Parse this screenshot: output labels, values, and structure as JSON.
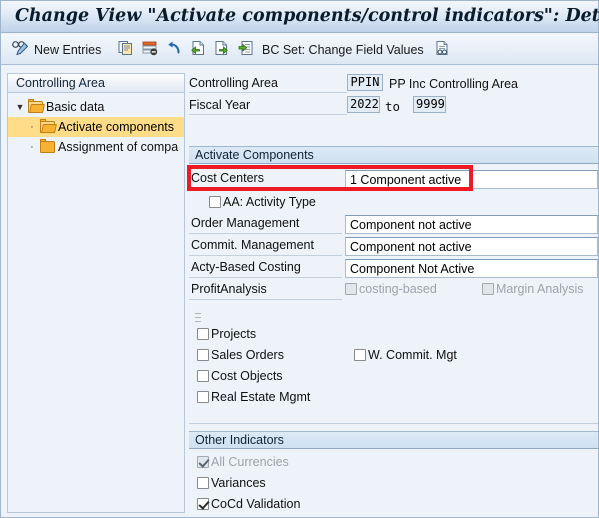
{
  "window": {
    "title": "Change View \"Activate components/control indicators\": Details"
  },
  "toolbar": {
    "items": [
      {
        "name": "display-change-icon",
        "icon": "glasses-pencil-icon",
        "label": ""
      },
      {
        "name": "new-entries-button",
        "icon": "",
        "label": "New Entries"
      },
      {
        "name": "copy-as-button",
        "icon": "copy-icon",
        "label": ""
      },
      {
        "name": "delete-button",
        "icon": "delete-row-icon",
        "label": ""
      },
      {
        "name": "undo-button",
        "icon": "undo-arrow-icon",
        "label": ""
      },
      {
        "name": "previous-entry-button",
        "icon": "page-left-arrow-icon",
        "label": ""
      },
      {
        "name": "next-entry-button",
        "icon": "page-right-arrow-icon",
        "label": ""
      },
      {
        "name": "select-entry-button",
        "icon": "page-list-arrow-icon",
        "label": ""
      },
      {
        "name": "bc-set-button",
        "icon": "",
        "label": "BC Set: Change Field Values"
      },
      {
        "name": "bc-set-display-button",
        "icon": "document-glasses-icon",
        "label": ""
      }
    ]
  },
  "tree": {
    "header": "Controlling Area",
    "nodes": [
      {
        "label": "Basic data",
        "level": 0,
        "expanded": true,
        "selected": false
      },
      {
        "label": "Activate components",
        "level": 1,
        "expanded": false,
        "selected": true
      },
      {
        "label": "Assignment of compa",
        "level": 1,
        "expanded": false,
        "selected": false
      }
    ]
  },
  "header_fields": {
    "controlling_area_label": "Controlling Area",
    "controlling_area_value": "PPIN",
    "controlling_area_text": "PP Inc Controlling Area",
    "fiscal_year_label": "Fiscal Year",
    "fiscal_year_from": "2022",
    "fiscal_year_to_label": "to",
    "fiscal_year_to": "9999"
  },
  "activate_components": {
    "section_title": "Activate Components",
    "rows": [
      {
        "label": "Cost Centers",
        "value": "1 Component active",
        "highlighted": true
      },
      {
        "label": "Order Management",
        "value": "Component not active",
        "highlighted": false
      },
      {
        "label": "Commit. Management",
        "value": "Component not active",
        "highlighted": false
      },
      {
        "label": "Acty-Based Costing",
        "value": "Component Not Active",
        "highlighted": false
      }
    ],
    "activity_type_checkbox": {
      "label": "AA: Activity Type",
      "checked": false,
      "disabled": false
    },
    "profit_analysis": {
      "label": "ProfitAnalysis",
      "costing_based": {
        "label": "costing-based",
        "checked": false,
        "disabled": true
      },
      "margin_analysis": {
        "label": "Margin Analysis",
        "checked": false,
        "disabled": true
      }
    },
    "checkboxes": [
      {
        "label": "Projects",
        "checked": false,
        "disabled": false
      },
      {
        "label": "Sales Orders",
        "checked": false,
        "disabled": false
      },
      {
        "label": "W. Commit. Mgt",
        "checked": false,
        "disabled": false
      },
      {
        "label": "Cost Objects",
        "checked": false,
        "disabled": false
      },
      {
        "label": "Real Estate Mgmt",
        "checked": false,
        "disabled": false
      }
    ]
  },
  "other_indicators": {
    "section_title": "Other Indicators",
    "checkboxes": [
      {
        "label": "All Currencies",
        "checked": true,
        "disabled": true
      },
      {
        "label": "Variances",
        "checked": false,
        "disabled": false
      },
      {
        "label": "CoCd Validation",
        "checked": true,
        "disabled": false
      }
    ]
  },
  "colors": {
    "highlight_red": "#ee1b24",
    "tree_selection": "#ffdd88",
    "section_header": "#cfe0f0"
  }
}
